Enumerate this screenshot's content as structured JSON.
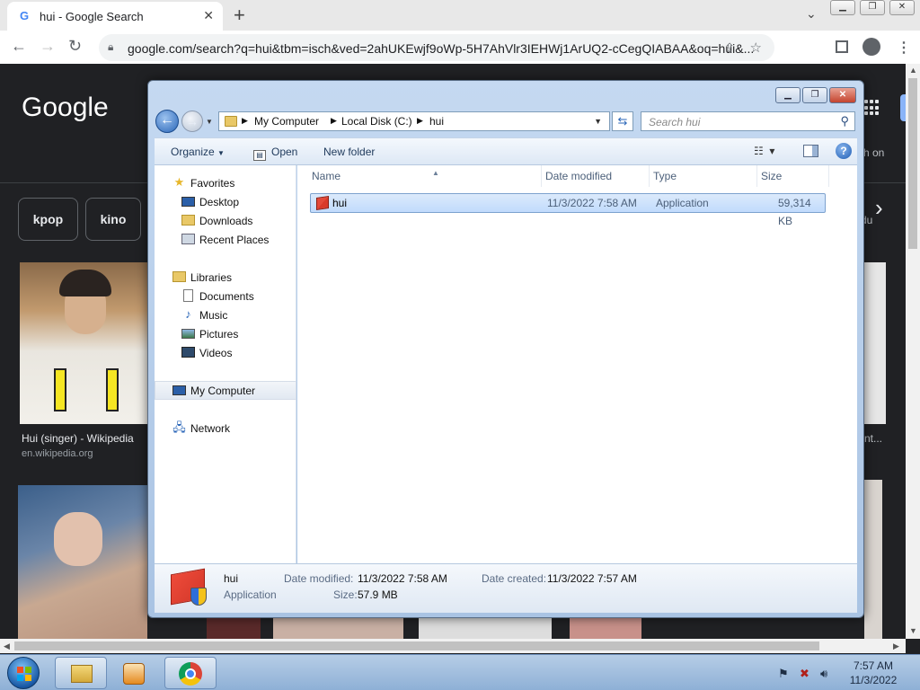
{
  "browser": {
    "tab_title": "hui - Google Search",
    "tab_favicon": "G",
    "url": "google.com/search?q=hui&tbm=isch&ved=2ahUKEwjf9oWp-5H7AhVlr3IEHWj1ArUQ2-cCegQIABAA&oq=hui&..."
  },
  "google": {
    "logo": "Google",
    "chips": [
      "kpop",
      "kino"
    ],
    "results": [
      {
        "caption": "Hui (singer) - Wikipedia",
        "source": "en.wikipedia.org"
      }
    ],
    "right_partial_1": "ch on",
    "right_partial_2": "du",
    "right_partial_3": "nt..."
  },
  "explorer": {
    "breadcrumb": [
      "My Computer",
      "Local Disk (C:)",
      "hui"
    ],
    "search_placeholder": "Search hui",
    "commands": {
      "organize": "Organize",
      "open": "Open",
      "new_folder": "New folder"
    },
    "nav": {
      "favorites": "Favorites",
      "desktop": "Desktop",
      "downloads": "Downloads",
      "recent_places": "Recent Places",
      "libraries": "Libraries",
      "documents": "Documents",
      "music": "Music",
      "pictures": "Pictures",
      "videos": "Videos",
      "my_computer": "My Computer",
      "network": "Network"
    },
    "columns": {
      "name": "Name",
      "date_modified": "Date modified",
      "type": "Type",
      "size": "Size"
    },
    "files": [
      {
        "name": "hui",
        "date_modified": "11/3/2022 7:58 AM",
        "type": "Application",
        "size": "59,314 KB"
      }
    ],
    "details": {
      "name": "hui",
      "kind": "Application",
      "date_modified_label": "Date modified:",
      "date_modified": "11/3/2022 7:58 AM",
      "date_created_label": "Date created:",
      "date_created": "11/3/2022 7:57 AM",
      "size_label": "Size:",
      "size": "57.9 MB"
    }
  },
  "taskbar": {
    "time": "7:57 AM",
    "date": "11/3/2022"
  }
}
